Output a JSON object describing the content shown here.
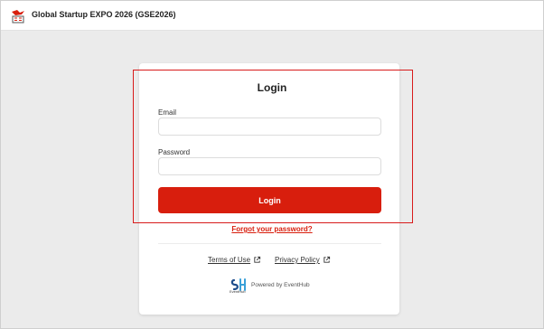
{
  "header": {
    "title": "Global Startup EXPO 2026 (GSE2026)",
    "logo_icon": "expo-logo-icon"
  },
  "login": {
    "title": "Login",
    "email_label": "Email",
    "email_value": "",
    "password_label": "Password",
    "password_value": "",
    "submit_label": "Login",
    "forgot_link": "Forgot your password?"
  },
  "footer": {
    "terms_label": "Terms of Use",
    "privacy_label": "Privacy Policy",
    "external_icon": "external-link-icon",
    "brand_name": "EventHub",
    "powered_by": "Powered by EventHub"
  },
  "colors": {
    "accent": "#d81e0d",
    "highlight_border": "#d81b1b",
    "background": "#ebebeb",
    "card": "#ffffff",
    "brand_blue": "#1f4e8c"
  }
}
